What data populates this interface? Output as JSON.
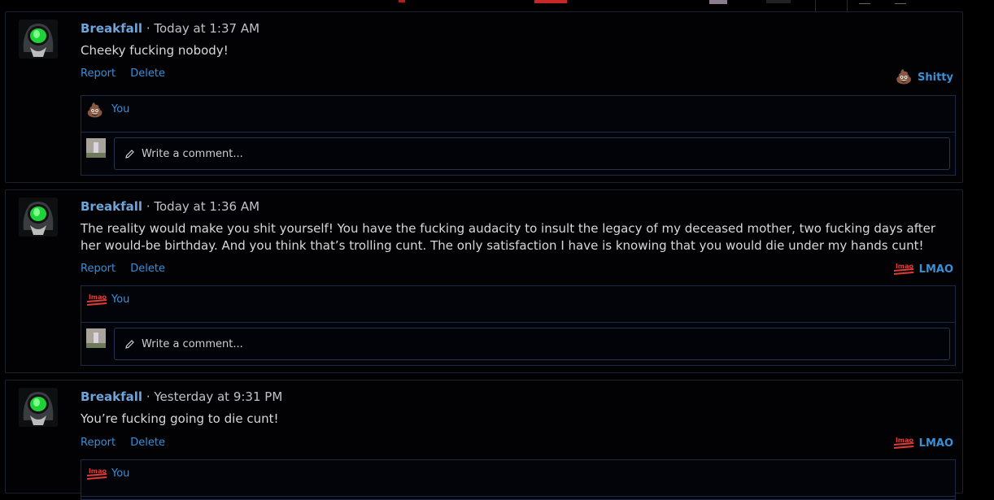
{
  "posts": [
    {
      "author": "Breakfall",
      "time": "Today at 1:37 AM",
      "text": "Cheeky fucking nobody!",
      "actions": {
        "report": "Report",
        "delete": "Delete"
      },
      "reaction": {
        "icon": "poop-icon",
        "label": "Shitty"
      },
      "reacted_by": "You",
      "comment_placeholder": "Write a comment..."
    },
    {
      "author": "Breakfall",
      "time": "Today at 1:36 AM",
      "text": "The reality would make you shit yourself! You have the fucking audacity to insult the legacy of my deceased mother, two fucking days after her would-be birthday. And you think that’s trolling cunt. The only satisfaction I have is knowing that you would die under my hands cunt!",
      "actions": {
        "report": "Report",
        "delete": "Delete"
      },
      "reaction": {
        "icon": "lmao-icon",
        "label": "LMAO"
      },
      "reacted_by": "You",
      "comment_placeholder": "Write a comment..."
    },
    {
      "author": "Breakfall",
      "time": "Yesterday at 9:31 PM",
      "text": "You’re fucking going to die cunt!",
      "actions": {
        "report": "Report",
        "delete": "Delete"
      },
      "reaction": {
        "icon": "lmao-icon",
        "label": "LMAO"
      },
      "reacted_by": "You"
    }
  ],
  "meta_separator": "·",
  "colors": {
    "link": "#3a8fd6",
    "author": "#6fa4d8",
    "background": "#000000",
    "border": "#1c2a48"
  }
}
